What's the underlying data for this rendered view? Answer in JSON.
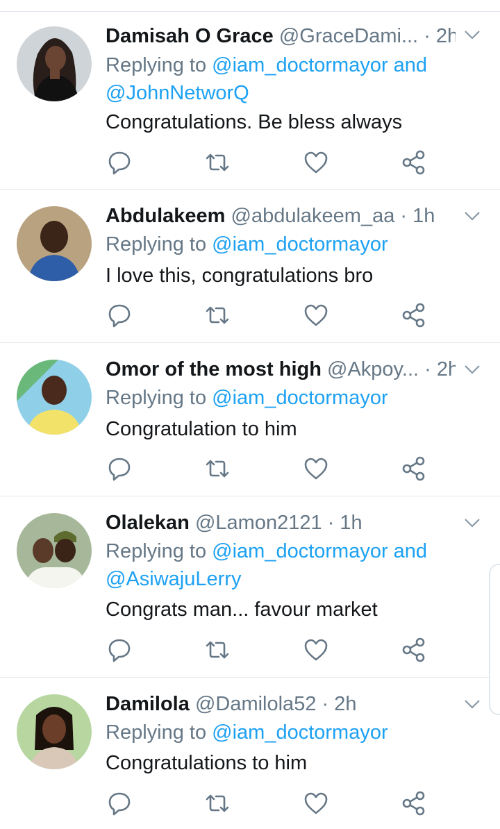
{
  "colors": {
    "link": "#1da1f2",
    "muted": "#657786",
    "text": "#14171a",
    "divider": "#e1e8ed"
  },
  "tweets": [
    {
      "name": "Damisah O Grace",
      "handle": "@GraceDami...",
      "dot": "·",
      "time": "2h",
      "reply_prefix": "Replying to",
      "reply_line1": "@iam_doctormayor and",
      "reply_line2": "@JohnNetworQ",
      "text": "Congratulations. Be bless always",
      "avatar_icon": "user-photo-woman"
    },
    {
      "name": "Abdulakeem",
      "handle": "@abdulakeem_aa",
      "dot": "·",
      "time": "1h",
      "reply_prefix": "Replying to",
      "reply_line1": "@iam_doctormayor",
      "reply_line2": "",
      "text": "I love this, congratulations bro",
      "avatar_icon": "user-photo-man"
    },
    {
      "name": "Omor of the most high",
      "handle": "@Akpoy...",
      "dot": "·",
      "time": "2h",
      "reply_prefix": "Replying to",
      "reply_line1": "@iam_doctormayor",
      "reply_line2": "",
      "text": "Congratulation to him",
      "avatar_icon": "user-photo-man-colorful"
    },
    {
      "name": "Olalekan",
      "handle": "@Lamon2121",
      "dot": "·",
      "time": "1h",
      "reply_prefix": "Replying to",
      "reply_line1": "@iam_doctormayor and",
      "reply_line2": "@AsiwajuLerry",
      "text": "Congrats man... favour market",
      "avatar_icon": "user-photo-men-group"
    },
    {
      "name": "Damilola",
      "handle": "@Damilola52",
      "dot": "·",
      "time": "2h",
      "reply_prefix": "Replying to",
      "reply_line1": "@iam_doctormayor",
      "reply_line2": "",
      "text": "Congratulations to him",
      "avatar_icon": "user-photo-woman-smiling"
    }
  ],
  "action_icons": [
    "reply-icon",
    "retweet-icon",
    "like-icon",
    "share-icon"
  ]
}
